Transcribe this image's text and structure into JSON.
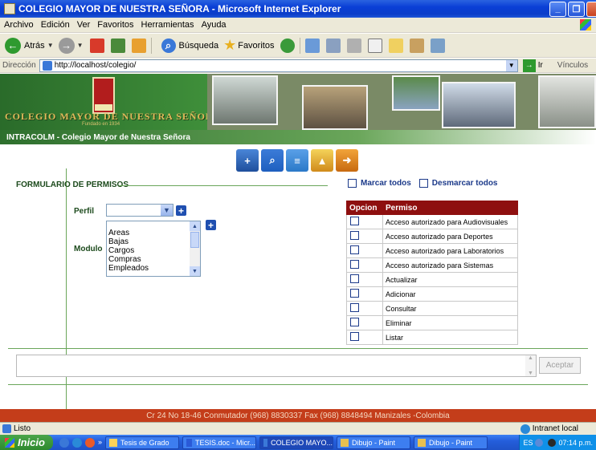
{
  "window": {
    "title": "COLEGIO MAYOR DE NUESTRA SEÑORA - Microsoft Internet Explorer"
  },
  "menu": [
    "Archivo",
    "Edición",
    "Ver",
    "Favoritos",
    "Herramientas",
    "Ayuda"
  ],
  "toolbar": {
    "back_label": "Atrás",
    "search_label": "Búsqueda",
    "favorites_label": "Favoritos"
  },
  "address": {
    "label": "Dirección",
    "url": "http://localhost/colegio/",
    "go_label": "Ir",
    "links_label": "Vínculos"
  },
  "banner": {
    "title": "COLEGIO MAYOR DE NUESTRA SEÑORA",
    "subtitle": "Fundado en 1934"
  },
  "nav": {
    "title": "INTRACOLM - Colegio Mayor de Nuestra Señora"
  },
  "form": {
    "title": "FORMULARIO DE PERMISOS",
    "perfil_label": "Perfil",
    "perfil_value": "",
    "modulo_label": "Modulo",
    "modulo_options": [
      "Areas",
      "Bajas",
      "Cargos",
      "Compras",
      "Empleados"
    ],
    "mark_all_label": "Marcar todos",
    "unmark_all_label": "Desmarcar todos",
    "textarea_value": "",
    "accept_label": "Aceptar"
  },
  "permissions_table": {
    "headers": [
      "Opcion",
      "Permiso"
    ],
    "rows": [
      "Acceso autorizado para Audiovisuales",
      "Acceso autorizado para Deportes",
      "Acceso autorizado para Laboratorios",
      "Acceso autorizado para Sistemas",
      "Actualizar",
      "Adicionar",
      "Consultar",
      "Eliminar",
      "Listar"
    ]
  },
  "footer": {
    "text": "Cr 24 No 18-46 Conmutador (968) 8830337 Fax (968) 8848494 Manizales -Colombia"
  },
  "status": {
    "text": "Listo",
    "zone": "Intranet local"
  },
  "taskbar": {
    "start_label": "Inicio",
    "tasks": [
      "Tesis de Grado",
      "TESIS.doc - Micr...",
      "COLEGIO MAYO...",
      "Dibujo - Paint",
      "Dibujo - Paint"
    ],
    "lang": "ES",
    "clock": "07:14 p.m."
  },
  "colors": {
    "accent_green": "#6aa65a",
    "table_header": "#8e0f0f",
    "footer_bg": "#c43d1a"
  }
}
